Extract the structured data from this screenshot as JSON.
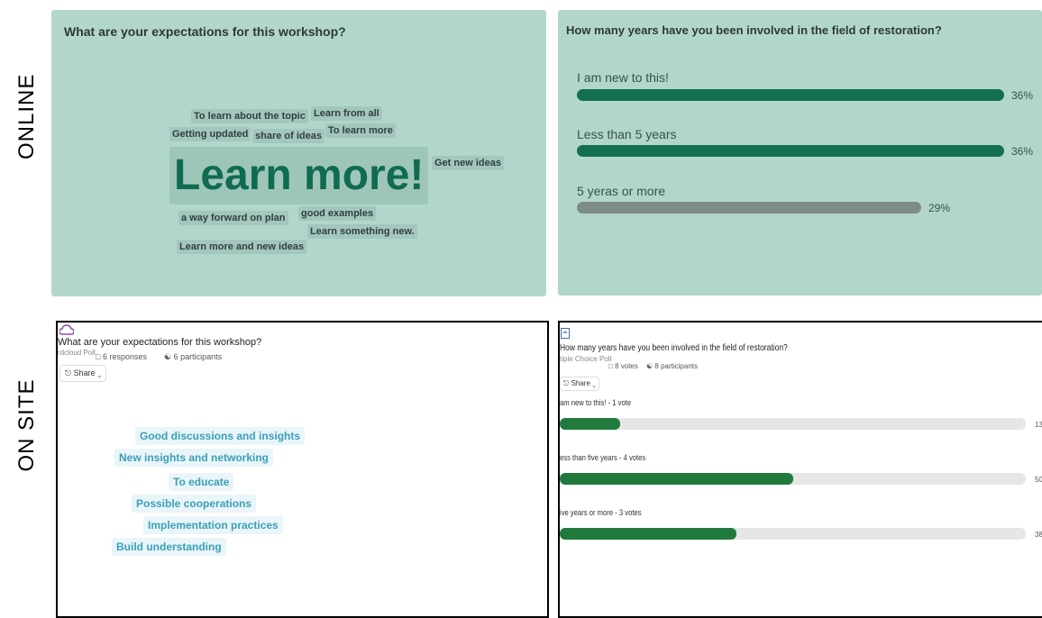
{
  "row_labels": {
    "online": "ONLINE",
    "onsite": "ON SITE"
  },
  "online_cloud": {
    "title": "What are your expectations for this workshop?",
    "big_word": "Learn more!",
    "words": [
      "To learn about the topic",
      "Learn from all",
      "Getting updated",
      "share of ideas",
      "To learn more",
      "Get new ideas",
      "a way forward on plan",
      "good examples",
      "Learn something new.",
      "Learn more and new ideas"
    ]
  },
  "online_poll": {
    "title": "How many years have you been involved in the field of restoration?",
    "options": [
      {
        "label": "I am new to this!",
        "value": 36,
        "pct_text": "36%",
        "color": "#13704f"
      },
      {
        "label": "Less than 5 years",
        "value": 36,
        "pct_text": "36%",
        "color": "#13704f"
      },
      {
        "label": "5 yeras or more",
        "value": 29,
        "pct_text": "29%",
        "color": "#7e8c86"
      }
    ]
  },
  "onsite_cloud": {
    "title": "What are your expectations for this workshop?",
    "type": "rdcloud Poll",
    "responses": "6 responses",
    "participants": "6 participants",
    "share": "Share",
    "words": [
      "Good discussions and insights",
      "New insights and networking",
      "To educate",
      "Possible cooperations",
      "Implementation practices",
      "Build understanding"
    ]
  },
  "onsite_poll": {
    "title": "How many years have you been involved in the field of restoration?",
    "type": "tiple Choice Poll",
    "votes": "8 votes",
    "participants": "8 participants",
    "share": "Share",
    "options": [
      {
        "label": "am new to this! - 1 vote",
        "value": 13,
        "pct_text": "13"
      },
      {
        "label": "ess than five years - 4 votes",
        "value": 50,
        "pct_text": "50"
      },
      {
        "label": "ive years or more - 3 votes",
        "value": 38,
        "pct_text": "38"
      }
    ],
    "bar_color": "#1f7a3c"
  }
}
